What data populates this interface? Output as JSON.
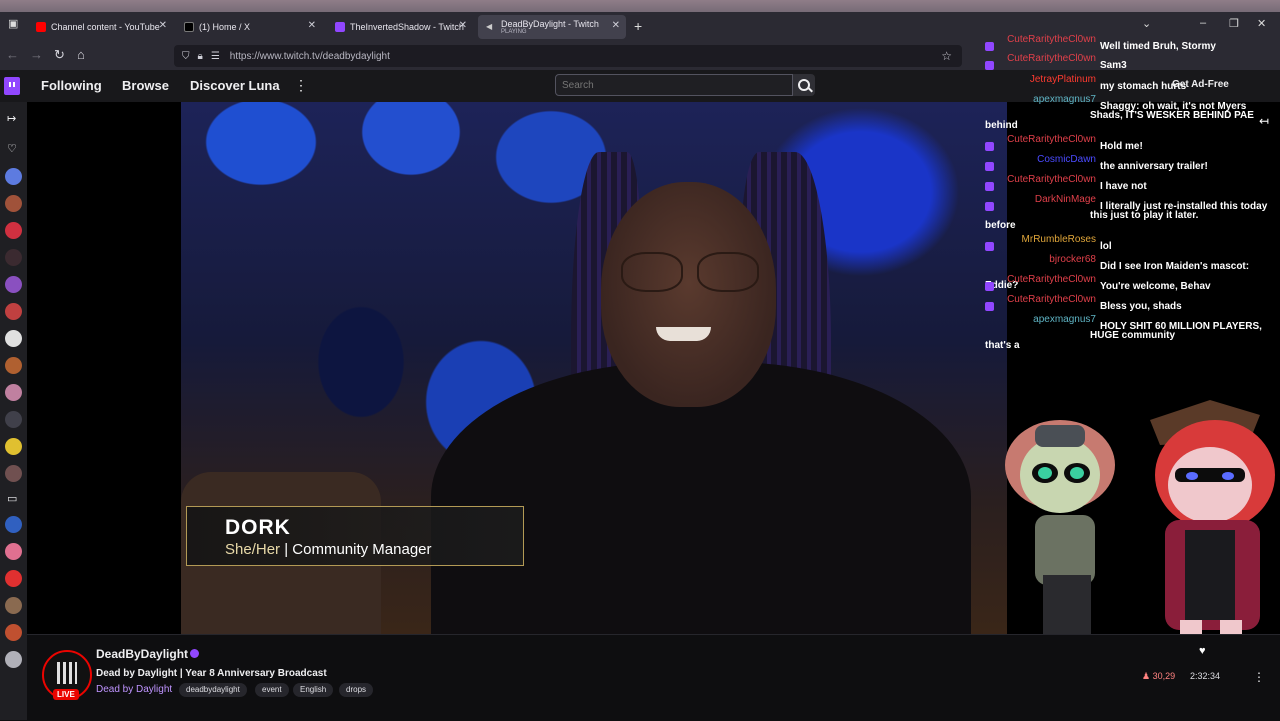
{
  "browser": {
    "tabs": [
      {
        "title": "Channel content - YouTube Studio",
        "fav": "#ff0000"
      },
      {
        "title": "(1) Home / X",
        "fav": "#000000"
      },
      {
        "title": "TheInvertedShadow - Twitch",
        "fav": "#9147ff"
      },
      {
        "title": "DeadByDaylight - Twitch",
        "sub": "PLAYING",
        "fav": "#9147ff"
      }
    ],
    "url": "https://www.twitch.tv/deadbydaylight"
  },
  "topnav": {
    "links": [
      "Following",
      "Browse",
      "Discover Luna"
    ],
    "search_placeholder": "Search",
    "adfree": "Get Ad-Free"
  },
  "lower_third": {
    "name": "DORK",
    "pronouns": "She/Her",
    "separator": "|",
    "role": "Community Manager"
  },
  "chat": [
    {
      "user": "CuteRaritytheCl0wn",
      "color": "#e0404a",
      "badge": true,
      "text": "Well timed Bruh, Stormy"
    },
    {
      "user": "CuteRaritytheCl0wn",
      "color": "#e0404a",
      "badge": true,
      "text": "Sam3"
    },
    {
      "user": "JetrayPlatinum",
      "color": "#ff3b30",
      "badge": false,
      "text": "my stomach hurts"
    },
    {
      "user": "apexmagnus7",
      "color": "#5fb4c4",
      "badge": false,
      "text": "Shaggy: oh wait, it's not Myers behind",
      "cont": "Shads, IT'S WESKER BEHIND PAE"
    },
    {
      "user": "CuteRaritytheCl0wn",
      "color": "#e0404a",
      "badge": true,
      "text": "Hold me!"
    },
    {
      "user": "CosmicDawn",
      "color": "#4b4bff",
      "badge": true,
      "text": "the anniversary trailer!"
    },
    {
      "user": "CuteRaritytheCl0wn",
      "color": "#e0404a",
      "badge": true,
      "text": "I have not"
    },
    {
      "user": "DarkNinMage",
      "color": "#e0404a",
      "badge": true,
      "text": "I literally just re-installed this today before",
      "cont": "this just to play it later."
    },
    {
      "user": "MrRumbleRoses",
      "color": "#e0a63a",
      "badge": true,
      "text": "lol"
    },
    {
      "user": "bjrocker68",
      "color": "#e0404a",
      "badge": false,
      "text": "Did I see Iron Maiden's mascot: Eddie?"
    },
    {
      "user": "CuteRaritytheCl0wn",
      "color": "#e0404a",
      "badge": true,
      "text": "You're welcome, Behav"
    },
    {
      "user": "CuteRaritytheCl0wn",
      "color": "#e0404a",
      "badge": true,
      "text": "Bless you, shads"
    },
    {
      "user": "apexmagnus7",
      "color": "#5fb4c4",
      "badge": false,
      "text": "HOLY SHIT 60 MILLION PLAYERS, that's a",
      "cont": "HUGE community"
    }
  ],
  "channel": {
    "name": "DeadByDaylight",
    "live": "LIVE",
    "title": "Dead by Daylight | Year 8 Anniversary Broadcast",
    "game": "Dead by Daylight",
    "tags": [
      "deadbydaylight",
      "event",
      "English",
      "drops"
    ],
    "viewers": "30,29",
    "uptime": "2:32:34"
  },
  "colors": {
    "twitch_purple": "#9147ff",
    "live_red": "#eb0400",
    "lower_third_gold": "#b39a55"
  }
}
